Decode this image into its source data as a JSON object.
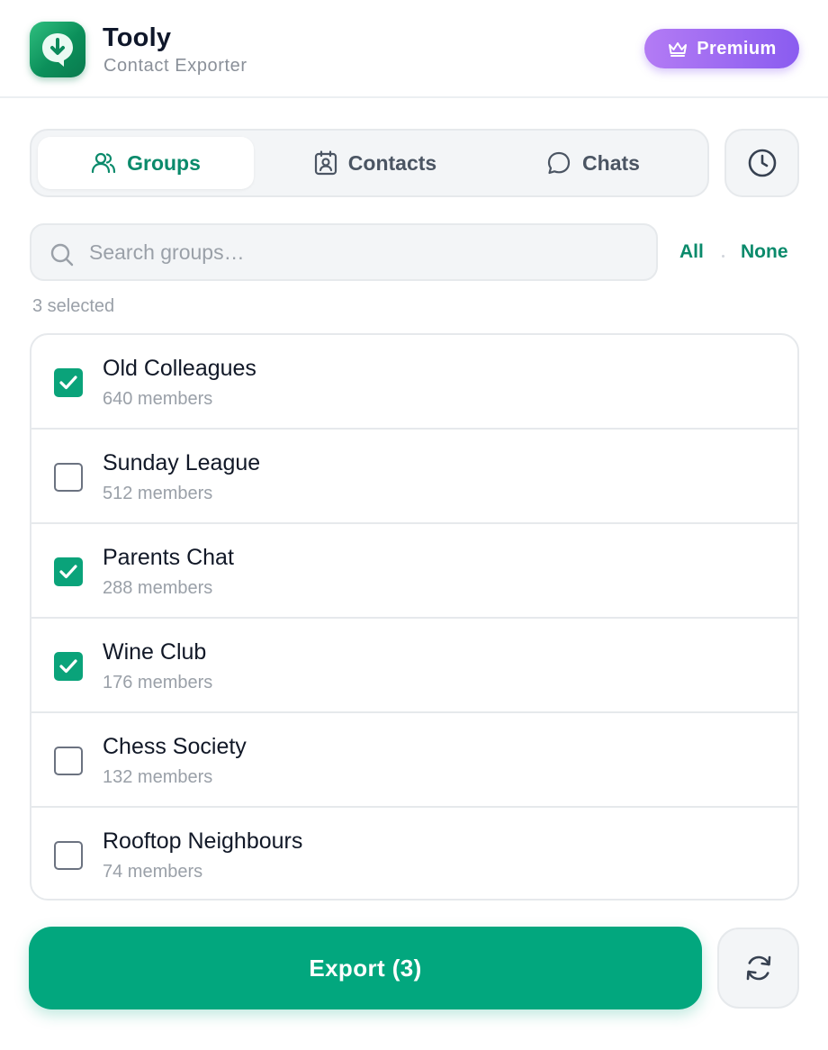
{
  "header": {
    "title": "Tooly",
    "subtitle": "Contact Exporter",
    "premium_label": "Premium",
    "logo_icon": "download-bubble-icon"
  },
  "tabs": [
    {
      "label": "Groups",
      "icon": "users-icon",
      "active": true
    },
    {
      "label": "Contacts",
      "icon": "contact-card-icon",
      "active": false
    },
    {
      "label": "Chats",
      "icon": "chat-bubble-icon",
      "active": false
    }
  ],
  "history_icon": "clock-icon",
  "search": {
    "placeholder": "Search groups…",
    "value": ""
  },
  "selection": {
    "all_label": "All",
    "none_label": "None",
    "count_text": "3 selected"
  },
  "groups": [
    {
      "name": "Old Colleagues",
      "members": "640 members",
      "checked": true
    },
    {
      "name": "Sunday League",
      "members": "512 members",
      "checked": false
    },
    {
      "name": "Parents Chat",
      "members": "288 members",
      "checked": true
    },
    {
      "name": "Wine Club",
      "members": "176 members",
      "checked": true
    },
    {
      "name": "Chess Society",
      "members": "132 members",
      "checked": false
    },
    {
      "name": "Rooftop Neighbours",
      "members": "74 members",
      "checked": false
    }
  ],
  "footer": {
    "export_label": "Export (3)",
    "refresh_icon": "refresh-icon"
  },
  "colors": {
    "accent": "#0a8a6b",
    "primary_button": "#02a77e",
    "premium_start": "#b37bf4",
    "premium_end": "#8a5cf0"
  }
}
